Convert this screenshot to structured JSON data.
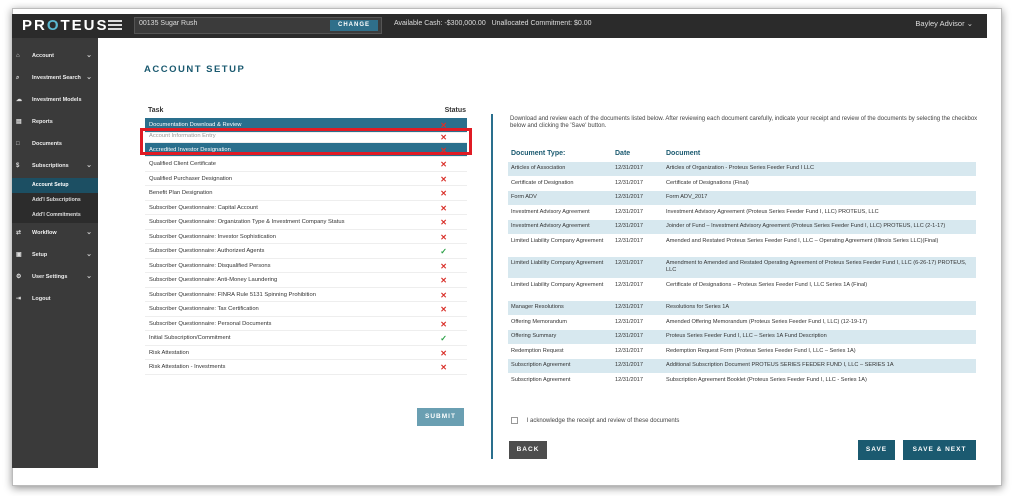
{
  "header": {
    "logo": "PROTEUS",
    "account_value": "00135 Sugar Rush",
    "change_label": "CHANGE",
    "available_cash": "Available Cash: -$300,000.00",
    "unallocated": "Unallocated Commitment: $0.00",
    "user": "Bayley Advisor"
  },
  "sidebar": {
    "items": [
      {
        "label": "Account",
        "icon": "home-icon",
        "chevron": true
      },
      {
        "label": "Investment Search",
        "icon": "search-icon",
        "chevron": true
      },
      {
        "label": "Investment Models",
        "icon": "cloud-icon",
        "chevron": false
      },
      {
        "label": "Reports",
        "icon": "chart-icon",
        "chevron": false
      },
      {
        "label": "Documents",
        "icon": "document-icon",
        "chevron": false
      },
      {
        "label": "Subscriptions",
        "icon": "dollar-icon",
        "chevron": true
      }
    ],
    "sub_items": [
      "Account Setup",
      "Add'l Subscriptions",
      "Add'l Commitments"
    ],
    "items_after": [
      {
        "label": "Workflow",
        "icon": "workflow-icon",
        "chevron": true
      },
      {
        "label": "Setup",
        "icon": "setup-icon",
        "chevron": true
      },
      {
        "label": "User Settings",
        "icon": "gear-icon",
        "chevron": true
      },
      {
        "label": "Logout",
        "icon": "logout-icon",
        "chevron": false
      }
    ]
  },
  "page": {
    "title": "ACCOUNT SETUP",
    "task_header": "Task",
    "status_header": "Status",
    "submit_label": "SUBMIT",
    "intro": "Download and review each of the documents listed below. After reviewing each document carefully, indicate your receipt and review of the documents by selecting the checkbox below and clicking the 'Save' button.",
    "ack_label": "I acknowledge the receipt and review of these documents",
    "back_label": "BACK",
    "save_label": "SAVE",
    "save_next_label": "SAVE & NEXT"
  },
  "tasks": [
    {
      "label": "Documentation Download & Review",
      "status": "x",
      "highlight": true
    },
    {
      "label": "Account Information Entry",
      "status": "x",
      "highlight": false
    },
    {
      "label": "Accredited Investor Designation",
      "status": "x",
      "highlight": true
    },
    {
      "label": "Qualified Client Certificate",
      "status": "x",
      "highlight": false
    },
    {
      "label": "Qualified Purchaser Designation",
      "status": "x",
      "highlight": false
    },
    {
      "label": "Benefit Plan Designation",
      "status": "x",
      "highlight": false
    },
    {
      "label": "Subscriber Questionnaire: Capital Account",
      "status": "x",
      "highlight": false
    },
    {
      "label": "Subscriber Questionnaire: Organization Type & Investment Company Status",
      "status": "x",
      "highlight": false
    },
    {
      "label": "Subscriber Questionnaire: Investor Sophistication",
      "status": "x",
      "highlight": false
    },
    {
      "label": "Subscriber Questionnaire: Authorized Agents",
      "status": "ok",
      "highlight": false
    },
    {
      "label": "Subscriber Questionnaire: Disqualified Persons",
      "status": "x",
      "highlight": false
    },
    {
      "label": "Subscriber Questionnaire: Anti-Money Laundering",
      "status": "x",
      "highlight": false
    },
    {
      "label": "Subscriber Questionnaire: FINRA Rule 5131 Spinning Prohibition",
      "status": "x",
      "highlight": false
    },
    {
      "label": "Subscriber Questionnaire: Tax Certification",
      "status": "x",
      "highlight": false
    },
    {
      "label": "Subscriber Questionnaire: Personal Documents",
      "status": "x",
      "highlight": false
    },
    {
      "label": "Initial Subscription/Commitment",
      "status": "ok",
      "highlight": false
    },
    {
      "label": "Risk Attestation",
      "status": "x",
      "highlight": false
    },
    {
      "label": "Risk Attestation - Investments",
      "status": "x",
      "highlight": false
    }
  ],
  "documents": {
    "headers": [
      "Document Type:",
      "Date",
      "Document"
    ],
    "rows": [
      {
        "type": "Articles of Association",
        "date": "12/31/2017",
        "doc": "Articles of Organization - Proteus Series Feeder Fund I LLC",
        "lines": 1
      },
      {
        "type": "Certificate of Designation",
        "date": "12/31/2017",
        "doc": "Certificate of Designations (Final)",
        "lines": 1
      },
      {
        "type": "Form ADV",
        "date": "12/31/2017",
        "doc": "Form ADV_2017",
        "lines": 1
      },
      {
        "type": "Investment Advisory Agreement",
        "date": "12/31/2017",
        "doc": "Investment Advisory Agreement (Proteus Series Feeder Fund I, LLC) PROTEUS, LLC",
        "lines": 1
      },
      {
        "type": "Investment Advisory Agreement",
        "date": "12/31/2017",
        "doc": "Joinder of Fund – Investment Advisory Agreement (Proteus Series Feeder Fund I, LLC) PROTEUS, LLC (2-1-17)",
        "lines": 1
      },
      {
        "type": "Limited Liability Company Agreement",
        "date": "12/31/2017",
        "doc": "Amended and Restated Proteus Series Feeder Fund I, LLC – Operating Agreement (Illinois Series LLC)(Final)",
        "lines": 2
      },
      {
        "type": "Limited Liability Company Agreement",
        "date": "12/31/2017",
        "doc": "Amendment to Amended and Restated Operating Agreement of Proteus Series Feeder Fund I, LLC (6-26-17) PROTEUS, LLC",
        "lines": 2
      },
      {
        "type": "Limited Liability Company Agreement",
        "date": "12/31/2017",
        "doc": "Certificate of Designations – Proteus Series Feeder Fund I, LLC Series 1A (Final)",
        "lines": 2
      },
      {
        "type": "Manager Resolutions",
        "date": "12/31/2017",
        "doc": "Resolutions for Series 1A",
        "lines": 1
      },
      {
        "type": "Offering Memorandum",
        "date": "12/31/2017",
        "doc": "Amended Offering Memorandum (Proteus Series Feeder Fund I, LLC) (12-19-17)",
        "lines": 1
      },
      {
        "type": "Offering Summary",
        "date": "12/31/2017",
        "doc": "Proteus Series Feeder Fund I, LLC – Series 1A Fund Description",
        "lines": 1
      },
      {
        "type": "Redemption Request",
        "date": "12/31/2017",
        "doc": "Redemption Request Form (Proteus Series Feeder Fund I, LLC – Series 1A)",
        "lines": 1
      },
      {
        "type": "Subscription Agreement",
        "date": "12/31/2017",
        "doc": "Additional Subscription Document PROTEUS SERIES FEEDER FUND I, LLC – SERIES 1A",
        "lines": 1
      },
      {
        "type": "Subscription Agreement",
        "date": "12/31/2017",
        "doc": "Subscription Agreement Booklet (Proteus Series Feeder Fund I, LLC - Series 1A)",
        "lines": 1
      }
    ]
  }
}
